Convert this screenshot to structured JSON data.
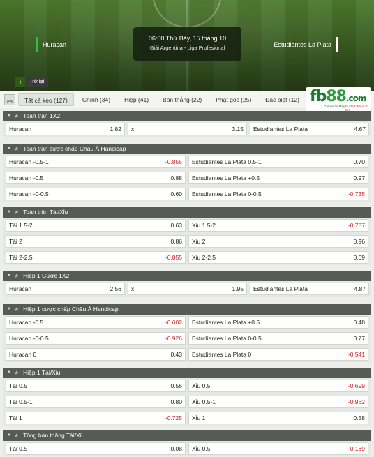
{
  "match": {
    "home": "Huracan",
    "away": "Estudiantes La Plata",
    "time": "06:00 Thứ Bảy, 15 tháng 10",
    "league": "Giải Argentina - Liga Profesional",
    "back_label": "Trở lại",
    "back_icon": "chevron-left-icon"
  },
  "brand": {
    "name_a": "fb",
    "name_b": "88",
    "name_c": ".com",
    "tag1": "Games To Play",
    "tag2": "Trusted Place To Bet"
  },
  "tabs": [
    {
      "label": "Tất cả kèo (127)",
      "active": true
    },
    {
      "label": "Chính (34)"
    },
    {
      "label": "Hiệp (41)"
    },
    {
      "label": "Bàn thắng (22)"
    },
    {
      "label": "Phạt góc (25)"
    },
    {
      "label": "Đặc biệt (12)"
    }
  ],
  "colors": {
    "negative": "#d42020",
    "header_bg": "#565b55",
    "accent_green": "#2bbf43"
  },
  "sections": [
    {
      "title": "Toàn trận 1X2",
      "rows": [
        [
          {
            "label": "Huracan",
            "odd": "1.82"
          },
          {
            "label": "x",
            "odd": "3.15"
          },
          {
            "label": "Estudiantes La Plata",
            "odd": "4.67"
          }
        ]
      ]
    },
    {
      "title": "Toàn trận cược chấp Châu Á Handicap",
      "rows": [
        [
          {
            "label": "Huracan -0.5-1",
            "odd": "-0.855"
          },
          {
            "label": "Estudiantes La Plata 0.5-1",
            "odd": "0.70"
          }
        ],
        [
          {
            "label": "Huracan -0.5",
            "odd": "0.88"
          },
          {
            "label": "Estudiantes La Plata +0.5",
            "odd": "0.97"
          }
        ],
        [
          {
            "label": "Huracan -0-0.5",
            "odd": "0.60"
          },
          {
            "label": "Estudiantes La Plata 0-0.5",
            "odd": "-0.735"
          }
        ]
      ]
    },
    {
      "title": "Toàn trận Tài/Xỉu",
      "rows": [
        [
          {
            "label": "Tài 1.5-2",
            "odd": "0.63"
          },
          {
            "label": "Xỉu 1.5-2",
            "odd": "-0.787"
          }
        ],
        [
          {
            "label": "Tài 2",
            "odd": "0.86"
          },
          {
            "label": "Xỉu 2",
            "odd": "0.96"
          }
        ],
        [
          {
            "label": "Tài 2-2.5",
            "odd": "-0.855"
          },
          {
            "label": "Xỉu 2-2.5",
            "odd": "0.69"
          }
        ]
      ]
    },
    {
      "title": "Hiệp 1 Cược 1X2",
      "rows": [
        [
          {
            "label": "Huracan",
            "odd": "2.56"
          },
          {
            "label": "x",
            "odd": "1.95"
          },
          {
            "label": "Estudiantes La Plata",
            "odd": "4.87"
          }
        ]
      ]
    },
    {
      "title": "Hiệp 1 cược chấp Châu Á Handicap",
      "rows": [
        [
          {
            "label": "Huracan -0.5",
            "odd": "-0.602"
          },
          {
            "label": "Estudiantes La Plata +0.5",
            "odd": "0.48"
          }
        ],
        [
          {
            "label": "Huracan -0-0.5",
            "odd": "-0.926"
          },
          {
            "label": "Estudiantes La Plata 0-0.5",
            "odd": "0.77"
          }
        ],
        [
          {
            "label": "Huracan 0",
            "odd": "0.43"
          },
          {
            "label": "Estudiantes La Plata 0",
            "odd": "-0.541"
          }
        ]
      ]
    },
    {
      "title": "Hiệp 1 Tài/Xỉu",
      "rows": [
        [
          {
            "label": "Tài 0.5",
            "odd": "0.56"
          },
          {
            "label": "Xỉu 0.5",
            "odd": "-0.699"
          }
        ],
        [
          {
            "label": "Tài 0.5-1",
            "odd": "0.80"
          },
          {
            "label": "Xỉu 0.5-1",
            "odd": "-0.962"
          }
        ],
        [
          {
            "label": "Tài 1",
            "odd": "-0.725"
          },
          {
            "label": "Xỉu 1",
            "odd": "0.58"
          }
        ]
      ]
    },
    {
      "title": "Tổng bàn thắng Tài/Xỉu",
      "rows": [
        [
          {
            "label": "Tài 0.5",
            "odd": "0.08"
          },
          {
            "label": "Xỉu 0.5",
            "odd": "-0.169"
          }
        ]
      ]
    }
  ]
}
